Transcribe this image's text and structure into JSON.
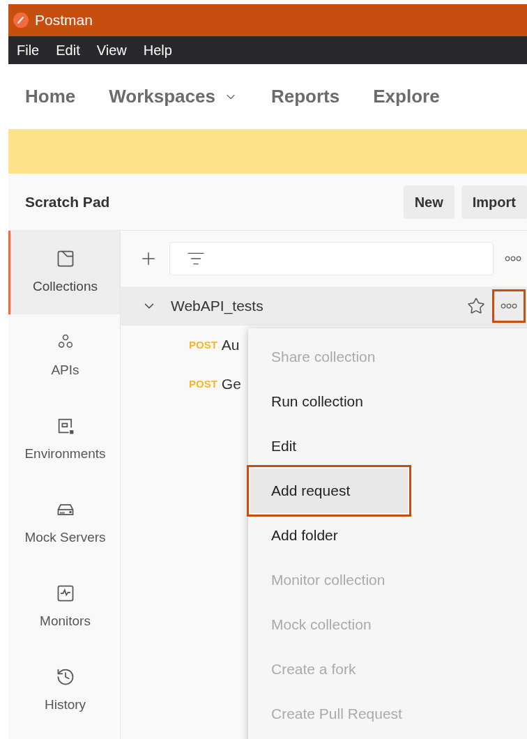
{
  "window": {
    "title": "Postman"
  },
  "menu_bar": [
    "File",
    "Edit",
    "View",
    "Help"
  ],
  "nav": [
    {
      "label": "Home",
      "dropdown": false
    },
    {
      "label": "Workspaces",
      "dropdown": true
    },
    {
      "label": "Reports",
      "dropdown": false
    },
    {
      "label": "Explore",
      "dropdown": false
    }
  ],
  "workspace": {
    "title": "Scratch Pad",
    "buttons": [
      "New",
      "Import"
    ]
  },
  "sidebar": {
    "items": [
      {
        "label": "Collections",
        "kind": "collections",
        "selected": true
      },
      {
        "label": "APIs",
        "kind": "apis",
        "selected": false
      },
      {
        "label": "Environments",
        "kind": "environments",
        "selected": false
      },
      {
        "label": "Mock Servers",
        "kind": "mock",
        "selected": false
      },
      {
        "label": "Monitors",
        "kind": "monitors",
        "selected": false
      },
      {
        "label": "History",
        "kind": "history",
        "selected": false
      }
    ]
  },
  "collection": {
    "name": "WebAPI_tests",
    "expanded": true,
    "starred": false,
    "more_outlined": true,
    "requests": [
      {
        "method": "POST",
        "name": "Au"
      },
      {
        "method": "POST",
        "name": "Ge"
      }
    ]
  },
  "context_menu": [
    {
      "label": "Share collection",
      "disabled": true,
      "selected": false,
      "outlined": false
    },
    {
      "label": "Run collection",
      "disabled": false,
      "selected": false,
      "outlined": false
    },
    {
      "label": "Edit",
      "disabled": false,
      "selected": false,
      "outlined": false
    },
    {
      "label": "Add request",
      "disabled": false,
      "selected": true,
      "outlined": true
    },
    {
      "label": "Add folder",
      "disabled": false,
      "selected": false,
      "outlined": false
    },
    {
      "label": "Monitor collection",
      "disabled": true,
      "selected": false,
      "outlined": false
    },
    {
      "label": "Mock collection",
      "disabled": true,
      "selected": false,
      "outlined": false
    },
    {
      "label": "Create a fork",
      "disabled": true,
      "selected": false,
      "outlined": false
    },
    {
      "label": "Create Pull Request",
      "disabled": true,
      "selected": false,
      "outlined": false
    }
  ]
}
